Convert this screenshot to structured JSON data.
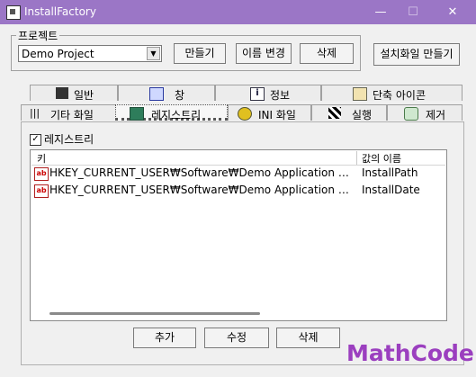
{
  "window": {
    "title": "InstallFactory",
    "minimize_label": "—",
    "maximize_label": "☐",
    "close_label": "✕"
  },
  "project": {
    "legend": "프로젝트",
    "selected": "Demo Project",
    "buttons": {
      "create": "만들기",
      "rename": "이름 변경",
      "delete": "삭제"
    },
    "build_button": "설치화일 만들기"
  },
  "tabs": {
    "row1": [
      "일반",
      "창",
      "정보",
      "단축 아이콘"
    ],
    "row2": [
      "기타 화일",
      "레지스트리",
      "INI 화일",
      "실행",
      "제거"
    ],
    "active": "레지스트리"
  },
  "registry": {
    "checkbox_label": "레지스트리",
    "checkbox_checked": true,
    "columns": {
      "key": "키",
      "value_name": "값의 이름"
    },
    "rows": [
      {
        "key": "HKEY_CURRENT_USER₩Software₩Demo Application Co...",
        "value_name": "InstallPath"
      },
      {
        "key": "HKEY_CURRENT_USER₩Software₩Demo Application Co...",
        "value_name": "InstallDate"
      }
    ],
    "buttons": {
      "add": "추가",
      "edit": "수정",
      "delete": "삭제"
    }
  },
  "watermark": "MathCode"
}
